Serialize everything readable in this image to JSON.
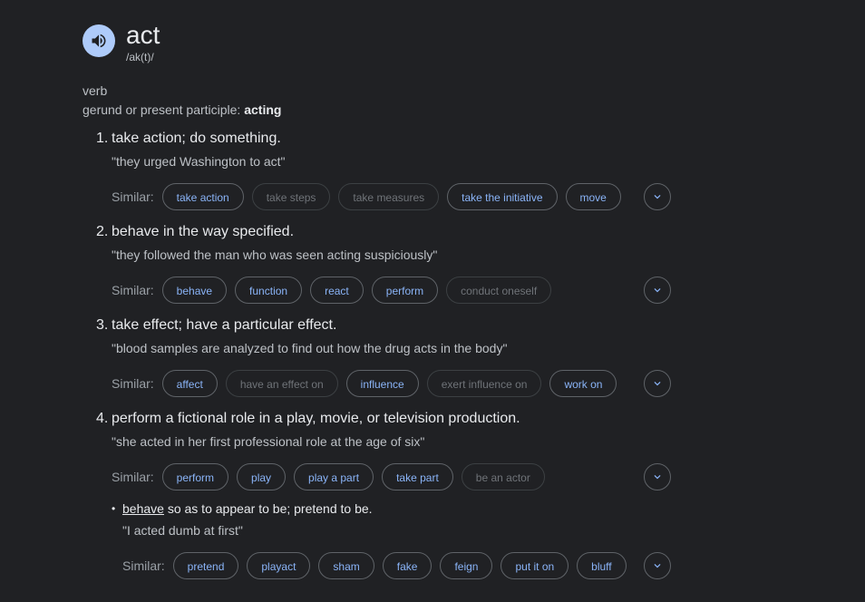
{
  "entry": {
    "word": "act",
    "phonetic": "/ak(t)/",
    "part_of_speech": "verb",
    "participle_label": "gerund or present participle:",
    "participle_value": "acting"
  },
  "similar_label": "Similar:",
  "senses": [
    {
      "number": "1.",
      "definition": "take action; do something.",
      "example": "\"they urged Washington to act\"",
      "similar": [
        {
          "text": "take action",
          "active": true
        },
        {
          "text": "take steps",
          "active": false
        },
        {
          "text": "take measures",
          "active": false
        },
        {
          "text": "take the initiative",
          "active": true
        },
        {
          "text": "move",
          "active": true
        }
      ]
    },
    {
      "number": "2.",
      "definition": "behave in the way specified.",
      "example": "\"they followed the man who was seen acting suspiciously\"",
      "similar": [
        {
          "text": "behave",
          "active": true
        },
        {
          "text": "function",
          "active": true
        },
        {
          "text": "react",
          "active": true
        },
        {
          "text": "perform",
          "active": true
        },
        {
          "text": "conduct oneself",
          "active": false
        }
      ]
    },
    {
      "number": "3.",
      "definition": "take effect; have a particular effect.",
      "example": "\"blood samples are analyzed to find out how the drug acts in the body\"",
      "similar": [
        {
          "text": "affect",
          "active": true
        },
        {
          "text": "have an effect on",
          "active": false
        },
        {
          "text": "influence",
          "active": true
        },
        {
          "text": "exert influence on",
          "active": false
        },
        {
          "text": "work on",
          "active": true
        }
      ]
    },
    {
      "number": "4.",
      "definition": "perform a fictional role in a play, movie, or television production.",
      "example": "\"she acted in her first professional role at the age of six\"",
      "similar": [
        {
          "text": "perform",
          "active": true
        },
        {
          "text": "play",
          "active": true
        },
        {
          "text": "play a part",
          "active": true
        },
        {
          "text": "take part",
          "active": true
        },
        {
          "text": "be an actor",
          "active": false
        }
      ]
    }
  ],
  "subsense": {
    "bullet": "•",
    "link_word": "behave",
    "definition_rest": " so as to appear to be; pretend to be.",
    "example": "\"I acted dumb at first\"",
    "similar": [
      {
        "text": "pretend",
        "active": true
      },
      {
        "text": "playact",
        "active": true
      },
      {
        "text": "sham",
        "active": true
      },
      {
        "text": "fake",
        "active": true
      },
      {
        "text": "feign",
        "active": true
      },
      {
        "text": "put it on",
        "active": true
      },
      {
        "text": "bluff",
        "active": true
      }
    ]
  },
  "icons": {
    "speaker": "speaker-icon",
    "expand": "chevron-down-icon"
  },
  "colors": {
    "background": "#202124",
    "link": "#8ab4f8",
    "speaker_bg": "#aecbfa"
  }
}
